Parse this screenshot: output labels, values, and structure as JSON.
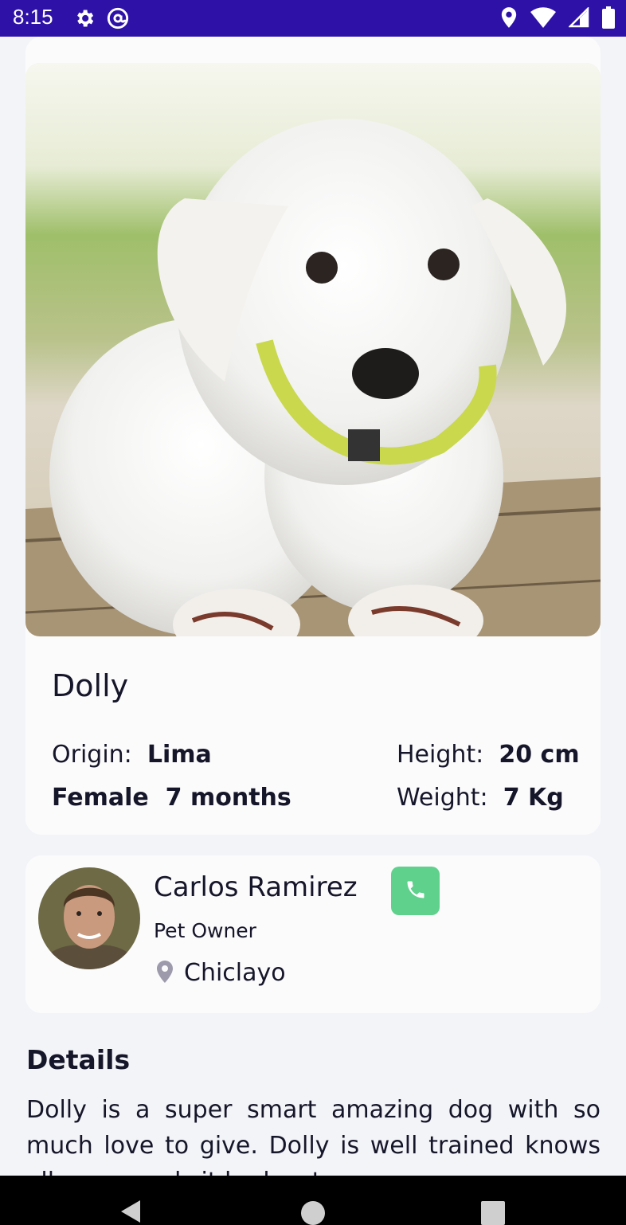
{
  "status_bar": {
    "time": "8:15",
    "left_icons": [
      "gear-icon",
      "at-sign-icon"
    ],
    "right_icons": [
      "location-pin-icon",
      "wifi-icon",
      "signal-icon",
      "battery-icon"
    ]
  },
  "pet": {
    "name": "Dolly",
    "origin_label": "Origin:",
    "origin_value": "Lima",
    "sex": "Female",
    "age": "7 months",
    "height_label": "Height:",
    "height_value": "20 cm",
    "weight_label": "Weight:",
    "weight_value": "7 Kg"
  },
  "owner": {
    "name": "Carlos Ramirez",
    "role": "Pet Owner",
    "location": "Chiclayo",
    "call_icon": "phone-icon",
    "location_icon": "map-pin-icon"
  },
  "details": {
    "title": "Details",
    "text": "Dolly is a super smart amazing dog with so much love to give. Dolly  is well trained knows all commands it had so to any"
  },
  "nav": {
    "icons": [
      "back-icon",
      "home-icon",
      "recents-icon"
    ]
  },
  "colors": {
    "status_bar": "#2e12a8",
    "call_button": "#5fd18c",
    "background": "#f3f4f8",
    "card": "#fbfbfc"
  }
}
